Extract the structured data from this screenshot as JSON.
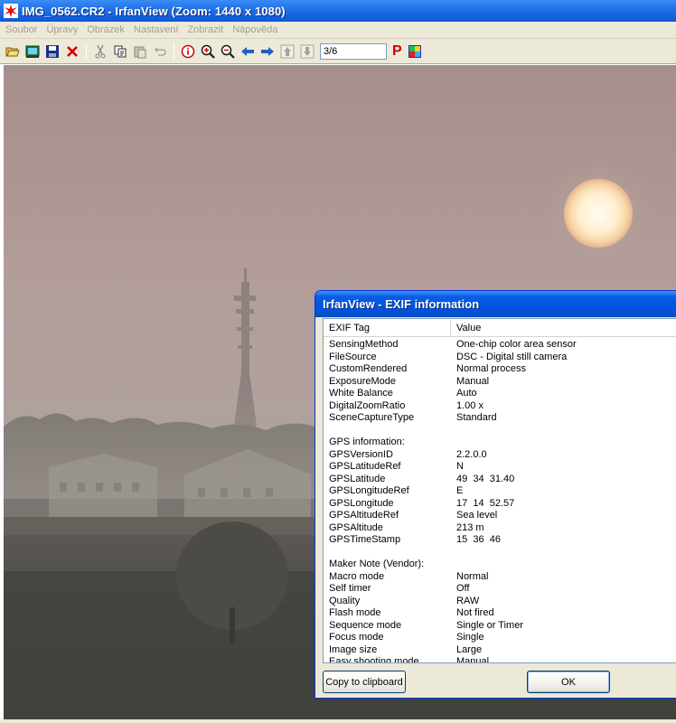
{
  "window": {
    "title": "IMG_0562.CR2 - IrfanView (Zoom: 1440 x 1080)"
  },
  "menu": [
    "Soubor",
    "Úpravy",
    "Obrázek",
    "Nastavení",
    "Zobrazit",
    "Nápověda"
  ],
  "toolbar": {
    "page_indicator": "3/6",
    "icons": [
      "open-folder-icon",
      "slideshow-icon",
      "save-icon",
      "delete-icon",
      "cut-icon",
      "copy-icon",
      "paste-icon",
      "undo-icon",
      "info-icon",
      "zoom-in-icon",
      "zoom-out-icon",
      "previous-icon",
      "next-icon",
      "first-page-icon",
      "last-page-icon",
      "paint-icon",
      "plugin-icon"
    ],
    "p_logo": "P"
  },
  "dialog": {
    "title": "IrfanView - EXIF information",
    "columns": {
      "tag": "EXIF Tag",
      "value": "Value"
    },
    "rows": [
      [
        "SensingMethod",
        "One-chip color area sensor"
      ],
      [
        "FileSource",
        "DSC - Digital still camera"
      ],
      [
        "CustomRendered",
        "Normal process"
      ],
      [
        "ExposureMode",
        "Manual"
      ],
      [
        "White Balance",
        "Auto"
      ],
      [
        "DigitalZoomRatio",
        "1.00 x"
      ],
      [
        "SceneCaptureType",
        "Standard"
      ],
      [
        "",
        ""
      ],
      [
        "GPS information:",
        ""
      ],
      [
        "GPSVersionID",
        "2.2.0.0"
      ],
      [
        "GPSLatitudeRef",
        "N"
      ],
      [
        "GPSLatitude",
        "49  34  31.40"
      ],
      [
        "GPSLongitudeRef",
        "E"
      ],
      [
        "GPSLongitude",
        "17  14  52.57"
      ],
      [
        "GPSAltitudeRef",
        "Sea level"
      ],
      [
        "GPSAltitude",
        "213 m"
      ],
      [
        "GPSTimeStamp",
        "15  36  46"
      ],
      [
        "",
        ""
      ],
      [
        "Maker Note (Vendor):",
        ""
      ],
      [
        "Macro mode",
        "Normal"
      ],
      [
        "Self timer",
        "Off"
      ],
      [
        "Quality",
        "RAW"
      ],
      [
        "Flash mode",
        "Not fired"
      ],
      [
        "Sequence mode",
        "Single or Timer"
      ],
      [
        "Focus mode",
        "Single"
      ],
      [
        "Image size",
        "Large"
      ],
      [
        "Easy shooting mode",
        "Manual"
      ]
    ],
    "copy_button": "Copy to clipboard",
    "ok_button": "OK"
  },
  "colors": {
    "title_bar": "#1f6fe8",
    "dialog_title": "#0054e3",
    "chrome": "#ece9d8",
    "sun": "#fff4dc"
  }
}
